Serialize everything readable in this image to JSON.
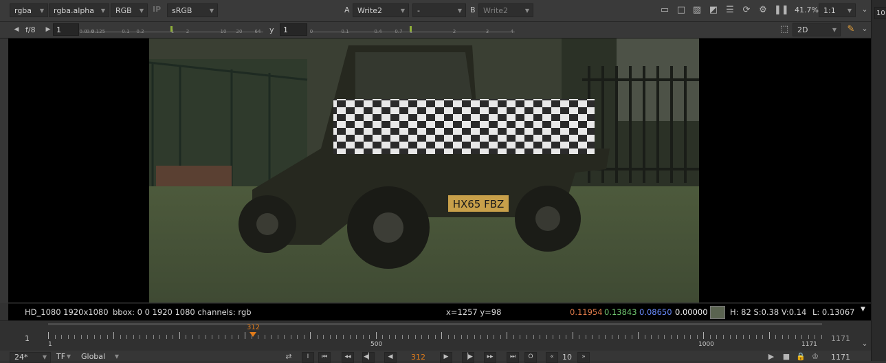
{
  "toolbar": {
    "channels": "rgba",
    "alpha_channel": "rgba.alpha",
    "display_channels": "RGB",
    "ip_label": "IP",
    "lut": "sRGB",
    "a_label": "A",
    "input_a": "Write2",
    "operation": "-",
    "b_label": "B",
    "input_b": "Write2",
    "zoom": "41.7%",
    "proxy": "1:1",
    "right_field": "10"
  },
  "controls": {
    "fstop": "f/8",
    "gain_value": "1",
    "gain_ticks": [
      "0.0",
      "0.0",
      "0.125",
      "0.1",
      "0.2",
      "1",
      "2",
      "10",
      "20",
      "64"
    ],
    "gamma_label": "y",
    "gamma_value": "1",
    "gamma_ticks": [
      "0",
      "0.1",
      "0.4",
      "0.7",
      "1",
      "2",
      "3",
      "4"
    ],
    "view_mode": "2D"
  },
  "info": {
    "format": "HD_1080 1920x1080",
    "bbox": "bbox: 0 0 1920 1080 channels: rgb",
    "coords": "x=1257 y=98",
    "r": "0.11954",
    "g": "0.13843",
    "b": "0.08650",
    "a": "0.00000",
    "swatch_color": "#5a6350",
    "hsv": "H: 82 S:0.38 V:0.14",
    "luma": "L: 0.13067"
  },
  "timeline": {
    "in_frame": "1",
    "current_frame": "312",
    "label_start": "1",
    "label_mid": "500",
    "label_1000": "1000",
    "label_end": "1171",
    "out_frame": "1171"
  },
  "transport": {
    "fps": "24*",
    "tf": "TF",
    "scope": "Global",
    "frame": "312",
    "increment": "10",
    "end_frame": "1171"
  },
  "photo": {
    "license_plate": "HX65 FBZ"
  },
  "colors": {
    "accent_orange": "#e07b1a",
    "slider_green": "#8fb03a"
  }
}
